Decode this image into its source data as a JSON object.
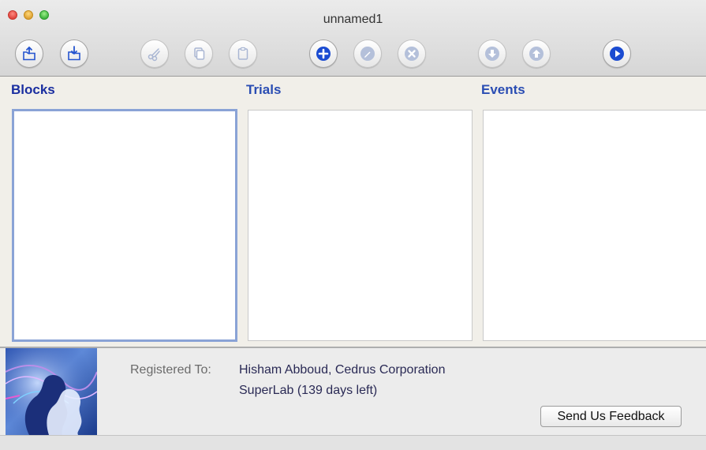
{
  "window": {
    "title": "unnamed1"
  },
  "toolbar": {
    "buttons": [
      {
        "name": "open-icon",
        "enabled": true
      },
      {
        "name": "save-icon",
        "enabled": true
      },
      {
        "name": "cut-icon",
        "enabled": false
      },
      {
        "name": "copy-icon",
        "enabled": false
      },
      {
        "name": "paste-icon",
        "enabled": false
      },
      {
        "name": "add-icon",
        "enabled": true
      },
      {
        "name": "edit-icon",
        "enabled": false
      },
      {
        "name": "delete-icon",
        "enabled": false
      },
      {
        "name": "move-down-icon",
        "enabled": false
      },
      {
        "name": "move-up-icon",
        "enabled": false
      },
      {
        "name": "run-icon",
        "enabled": true
      }
    ],
    "colors": {
      "active": "#1a4bd1",
      "disabled": "#b4c0da"
    }
  },
  "columns": {
    "blocks": {
      "title": "Blocks"
    },
    "trials": {
      "title": "Trials"
    },
    "events": {
      "title": "Events"
    }
  },
  "registration": {
    "label": "Registered To:",
    "name": "Hisham Abboud,  Cedrus Corporation",
    "product": "SuperLab (139 days left)"
  },
  "feedback": {
    "label": "Send Us Feedback"
  }
}
